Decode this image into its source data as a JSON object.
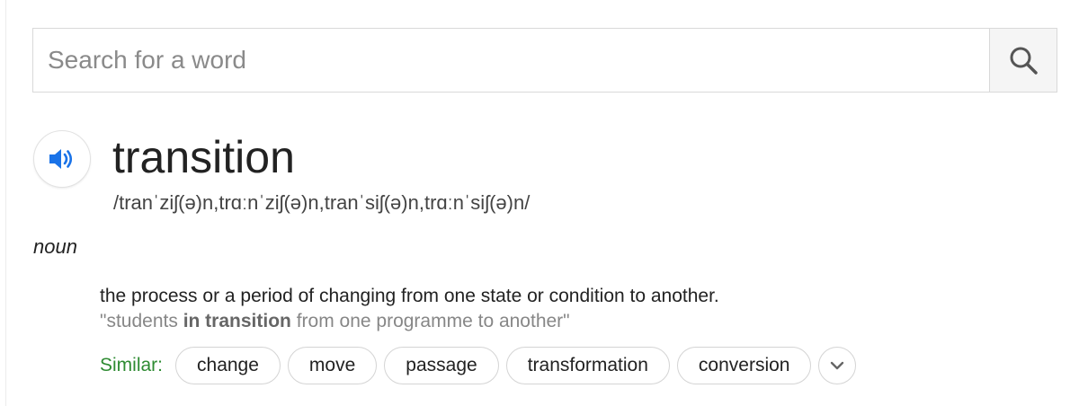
{
  "search": {
    "placeholder": "Search for a word",
    "value": "",
    "button_icon": "search-icon"
  },
  "entry": {
    "audio_icon": "speaker-icon",
    "word": "transition",
    "pronunciation": "/tranˈziʃ(ə)n,trɑːnˈziʃ(ə)n,tranˈsiʃ(ə)n,trɑːnˈsiʃ(ə)n/",
    "part_of_speech": "noun",
    "definition": "the process or a period of changing from one state or condition to another.",
    "example": {
      "before": "\"students ",
      "highlight": "in transition",
      "after": " from one programme to another\""
    },
    "similar": {
      "label": "Similar:",
      "words": [
        "change",
        "move",
        "passage",
        "transformation",
        "conversion"
      ],
      "expand_icon": "chevron-down-icon"
    }
  },
  "colors": {
    "accent_blue": "#1a73e8",
    "similar_green": "#2e8b32",
    "example_gray": "#878787"
  }
}
